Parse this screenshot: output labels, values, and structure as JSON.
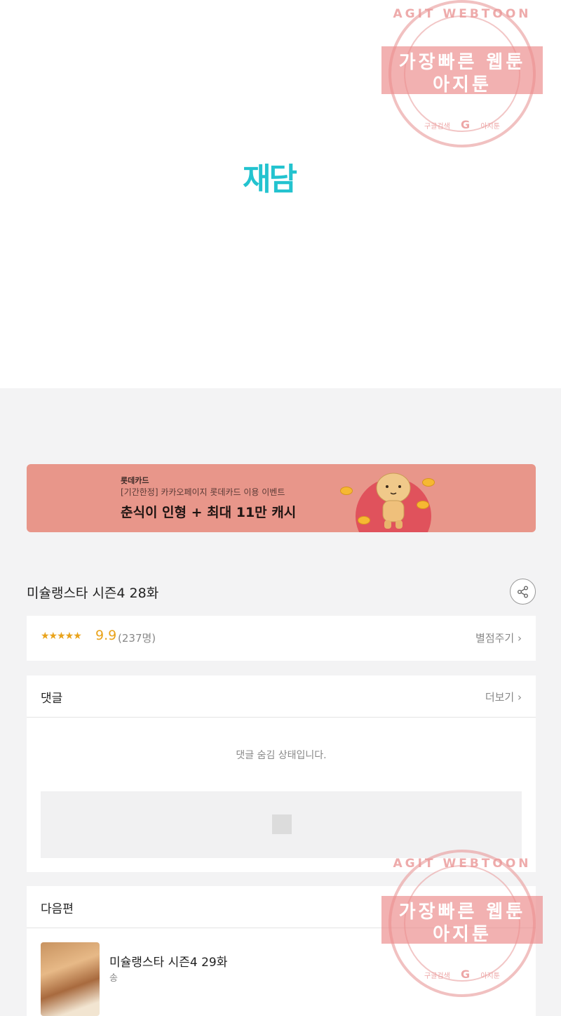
{
  "logo": {
    "text": "재담",
    "color": "#23c3cf"
  },
  "banner": {
    "brand": "롯데카드",
    "subtitle": "[기간한정] 카카오페이지 롯데카드 이용 이벤트",
    "headline": "춘식이 인형 + 최대 11만 캐시",
    "background": "#e8968a"
  },
  "episode": {
    "title": "미슐랭스타 시즌4 28화",
    "share_icon": "share-icon"
  },
  "rating": {
    "stars": "★★★★★",
    "score": "9.9",
    "count": "(237명)",
    "rate_link": "별점주기 ›",
    "accent": "#e9a31b"
  },
  "comments": {
    "title": "댓글",
    "more": "더보기 ›",
    "hidden_message": "댓글 숨김 상태입니다."
  },
  "next": {
    "title": "다음편",
    "episode_title": "미슐랭스타 시즌4 29화",
    "author": "송"
  },
  "watermark": {
    "top_arc": "AGIT WEBTOON",
    "line1": "가장빠른 웹툰",
    "line2": "아지툰",
    "bottom_left": "구글검색",
    "bottom_mid": "G",
    "bottom_right": "아지툰"
  }
}
